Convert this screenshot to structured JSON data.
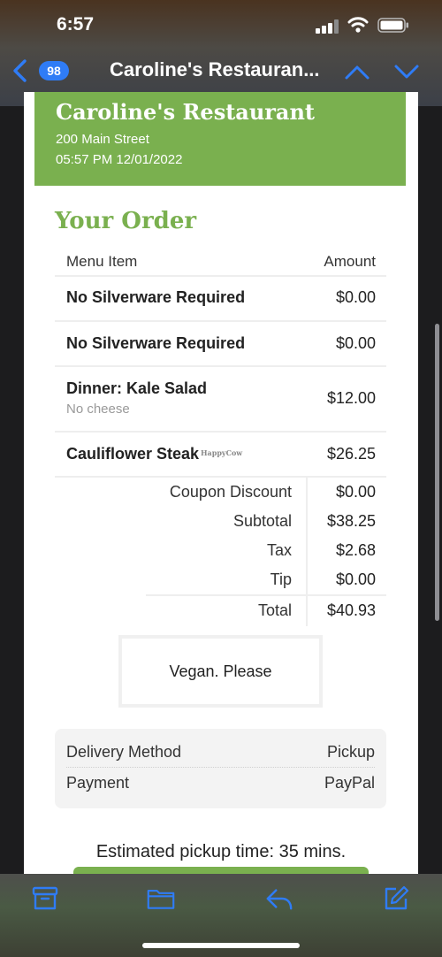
{
  "status": {
    "time": "6:57"
  },
  "nav": {
    "badge": "98",
    "title": "Caroline's Restauran..."
  },
  "restaurant": {
    "name": "Caroline's Restaurant",
    "address": "200 Main Street",
    "datetime": "05:57 PM 12/01/2022"
  },
  "order": {
    "heading": "Your Order",
    "col_item": "Menu Item",
    "col_amount": "Amount",
    "items": [
      {
        "name": "No Silverware Required",
        "note": "",
        "amount": "$0.00"
      },
      {
        "name": "No Silverware Required",
        "note": "",
        "amount": "$0.00"
      },
      {
        "name": "Dinner: Kale Salad",
        "note": "No cheese",
        "amount": "$12.00"
      },
      {
        "name": "Cauliflower Steak",
        "note": "",
        "amount": "$26.25"
      }
    ],
    "watermark": "HappyCow",
    "summary": [
      {
        "label": "Coupon Discount",
        "value": "$0.00"
      },
      {
        "label": "Subtotal",
        "value": "$38.25"
      },
      {
        "label": "Tax",
        "value": "$2.68"
      },
      {
        "label": "Tip",
        "value": "$0.00"
      },
      {
        "label": "Total",
        "value": "$40.93"
      }
    ],
    "note": "Vegan. Please"
  },
  "info": {
    "delivery_label": "Delivery Method",
    "delivery_value": "Pickup",
    "payment_label": "Payment",
    "payment_value": "PayPal"
  },
  "pickup": "Estimated pickup time: 35 mins.",
  "colors": {
    "accent": "#7ab04f",
    "ios_blue": "#2f7cf6"
  },
  "icons": {
    "nav": [
      "back-chevron-icon",
      "up-chevron-icon",
      "down-chevron-icon"
    ],
    "toolbar": [
      "archive-icon",
      "folder-icon",
      "reply-icon",
      "compose-icon"
    ]
  }
}
